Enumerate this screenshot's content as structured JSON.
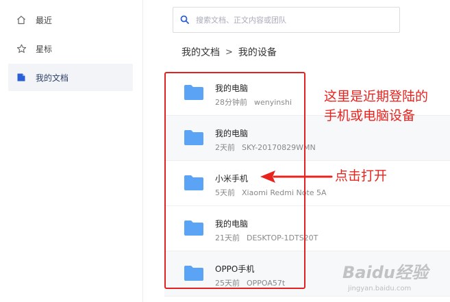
{
  "sidebar": {
    "items": [
      {
        "label": "最近",
        "icon": "home-icon"
      },
      {
        "label": "星标",
        "icon": "star-icon"
      },
      {
        "label": "我的文档",
        "icon": "document-icon",
        "active": true
      }
    ]
  },
  "search": {
    "placeholder": "搜索文档、正文内容或团队"
  },
  "breadcrumb": {
    "root": "我的文档",
    "separator": ">",
    "current": "我的设备"
  },
  "devices": [
    {
      "name": "我的电脑",
      "time": "28分钟前",
      "device": "wenyinshi"
    },
    {
      "name": "我的电脑",
      "time": "2天前",
      "device": "SKY-20170829WMN"
    },
    {
      "name": "小米手机",
      "time": "5天前",
      "device": "Xiaomi Redmi Note 5A"
    },
    {
      "name": "我的电脑",
      "time": "21天前",
      "device": "DESKTOP-1DTS20T"
    },
    {
      "name": "OPPO手机",
      "time": "25天前",
      "device": "OPPOA57t"
    }
  ],
  "annotations": {
    "line1": "这里是近期登陆的",
    "line2": "手机或电脑设备",
    "click_hint": "点击打开"
  },
  "watermark": {
    "brand": "Baidu经验",
    "sub": "jingyan.baidu.com"
  },
  "colors": {
    "folder": "#5ba3f5",
    "accent": "#2c5fd6",
    "annotation": "#e8231e"
  }
}
